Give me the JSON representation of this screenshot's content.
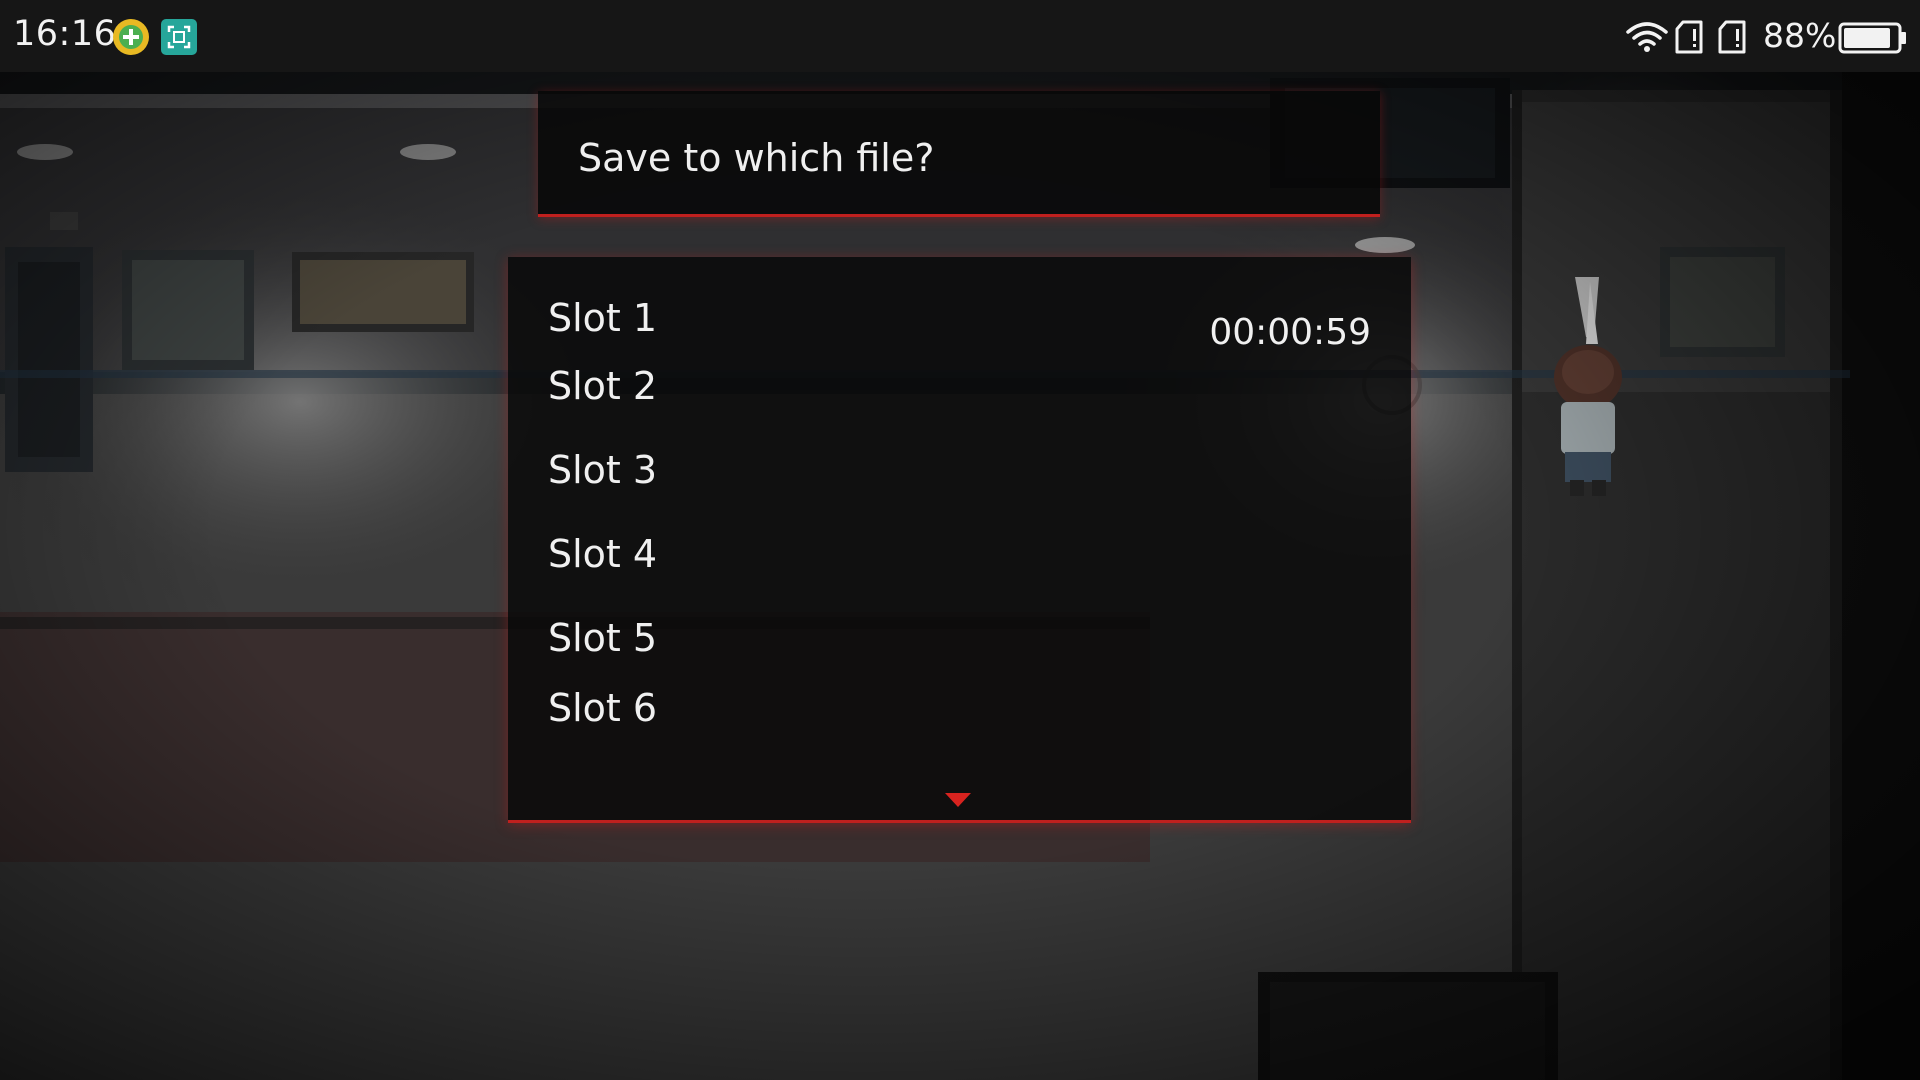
{
  "status_bar": {
    "time": "16:16",
    "battery_percent_label": "88%",
    "battery_level": 0.88,
    "icons": [
      "add-app-icon",
      "screenshot-app-icon",
      "wifi-icon",
      "sim-1-icon",
      "sim-2-icon",
      "battery-icon"
    ]
  },
  "dialog": {
    "prompt": "Save to which file?",
    "slots": [
      {
        "label": "Slot 1",
        "playtime": "00:00:59"
      },
      {
        "label": "Slot 2"
      },
      {
        "label": "Slot 3"
      },
      {
        "label": "Slot 4"
      },
      {
        "label": "Slot 5"
      },
      {
        "label": "Slot 6"
      }
    ],
    "selected_slot": "Slot 1",
    "scroll_indicator": "down-arrow-icon"
  },
  "colors": {
    "accent_red": "#c0201e",
    "window_bg": "#080808",
    "text": "#f0f0f0",
    "status_bar_bg": "#161616"
  }
}
